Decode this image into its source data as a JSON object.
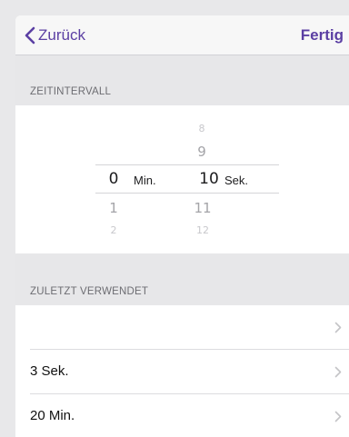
{
  "navbar": {
    "back_label": "Zurück",
    "done_label": "Fertig",
    "accent_color": "#5b3fa3"
  },
  "interval_section": {
    "header": "ZEITINTERVALL"
  },
  "picker": {
    "minutes": {
      "selected": "0",
      "unit": "Min.",
      "below": [
        "1",
        "2"
      ]
    },
    "seconds": {
      "above": [
        "8",
        "9"
      ],
      "selected": "10",
      "unit": "Sek.",
      "below": [
        "11",
        "12"
      ]
    }
  },
  "recent_section": {
    "header": "ZULETZT VERWENDET",
    "items": [
      {
        "label": ""
      },
      {
        "label": "3 Sek."
      },
      {
        "label": "20 Min."
      }
    ]
  },
  "icons": {
    "back": "chevron-left-icon",
    "row": "chevron-right-icon"
  }
}
